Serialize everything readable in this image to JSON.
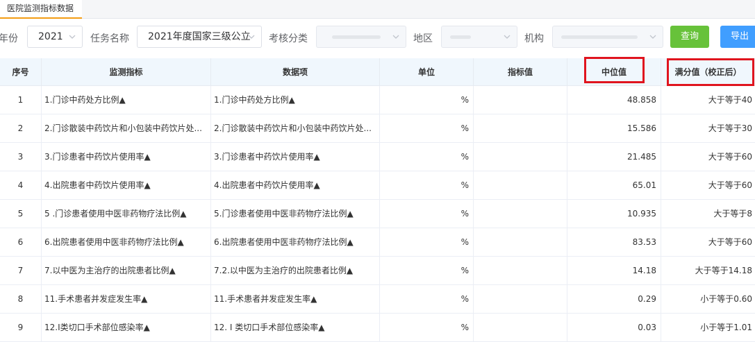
{
  "tab": {
    "label": "医院监测指标数据"
  },
  "filters": {
    "year_label": "年份",
    "year_value": "2021",
    "task_label": "任务名称",
    "task_value": "2021年度国家三级公立",
    "category_label": "考核分类",
    "region_label": "地区",
    "org_label": "机构",
    "query_button": "查询",
    "export_button": "导出"
  },
  "table": {
    "headers": [
      "序号",
      "监测指标",
      "数据项",
      "单位",
      "指标值",
      "中位值",
      "满分值（校正后）"
    ],
    "rows": [
      [
        "1",
        "1.门诊中药处方比例▲",
        "1.门诊中药处方比例▲",
        "%",
        "",
        "48.858",
        "大于等于40"
      ],
      [
        "2",
        "2.门诊散装中药饮片和小包装中药饮片处...",
        "2.门诊散装中药饮片和小包装中药饮片处...",
        "%",
        "",
        "15.586",
        "大于等于30"
      ],
      [
        "3",
        "3.门诊患者中药饮片使用率▲",
        "3.门诊患者中药饮片使用率▲",
        "%",
        "",
        "21.485",
        "大于等于60"
      ],
      [
        "4",
        "4.出院患者中药饮片使用率▲",
        "4.出院患者中药饮片使用率▲",
        "%",
        "",
        "65.01",
        "大于等于60"
      ],
      [
        "5",
        "5 .门诊患者使用中医非药物疗法比例▲",
        "5.门诊患者使用中医非药物疗法比例▲",
        "%",
        "",
        "10.935",
        "大于等于8"
      ],
      [
        "6",
        "6.出院患者使用中医非药物疗法比例▲",
        "6.出院患者使用中医非药物疗法比例▲",
        "%",
        "",
        "83.53",
        "大于等于60"
      ],
      [
        "7",
        "7.以中医为主治疗的出院患者比例▲",
        "7.2.以中医为主治疗的出院患者比例▲",
        "%",
        "",
        "14.18",
        "大于等于14.18"
      ],
      [
        "8",
        "11.手术患者并发症发生率▲",
        "11.手术患者并发症发生率▲",
        "%",
        "",
        "0.29",
        "小于等于0.60"
      ],
      [
        "9",
        "12.I类切口手术部位感染率▲",
        "12. I 类切口手术部位感染率▲",
        "%",
        "",
        "0.03",
        "小于等于1.01"
      ]
    ]
  },
  "colors": {
    "highlight": "#e0141e",
    "query": "#67c23a",
    "export": "#409eff",
    "header_bg": "#f0f7fd"
  },
  "icons": [
    "chevron-down-icon"
  ]
}
